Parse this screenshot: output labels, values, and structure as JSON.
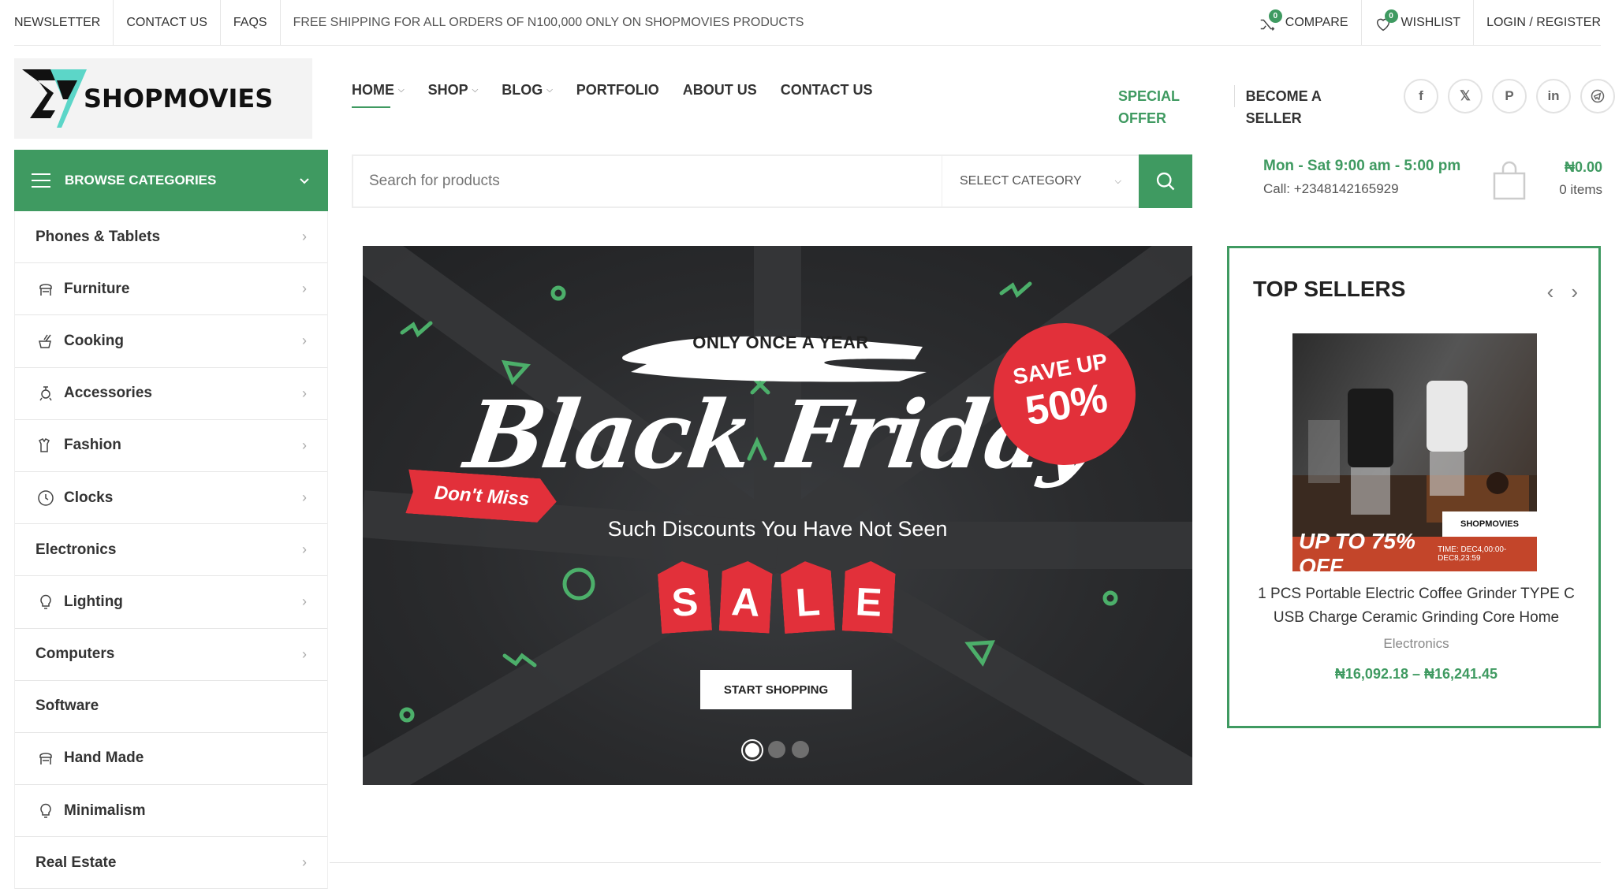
{
  "topbar": {
    "links": [
      "NEWSLETTER",
      "CONTACT US",
      "FAQS"
    ],
    "shipping_notice": "FREE SHIPPING FOR ALL ORDERS OF N100,000 ONLY ON SHOPMOVIES PRODUCTS",
    "compare": {
      "label": "COMPARE",
      "count": "0"
    },
    "wishlist": {
      "label": "WISHLIST",
      "count": "0"
    },
    "login": "LOGIN / REGISTER"
  },
  "header": {
    "logo_text": "SHOPMOVIES",
    "nav": [
      {
        "label": "HOME",
        "dropdown": true
      },
      {
        "label": "SHOP",
        "dropdown": true
      },
      {
        "label": "BLOG",
        "dropdown": true
      },
      {
        "label": "PORTFOLIO",
        "dropdown": false
      },
      {
        "label": "ABOUT US",
        "dropdown": false
      },
      {
        "label": "CONTACT US",
        "dropdown": false
      }
    ],
    "special_offer": "SPECIAL OFFER",
    "become_seller": "BECOME A SELLER",
    "social": [
      "facebook-icon",
      "x-icon",
      "pinterest-icon",
      "linkedin-icon",
      "telegram-icon"
    ]
  },
  "browse": {
    "label": "BROWSE CATEGORIES",
    "categories": [
      {
        "label": "Phones & Tablets",
        "icon": "",
        "arrow": true
      },
      {
        "label": "Furniture",
        "icon": "chair-icon",
        "arrow": true
      },
      {
        "label": "Cooking",
        "icon": "cooking-icon",
        "arrow": true
      },
      {
        "label": "Accessories",
        "icon": "accessories-icon",
        "arrow": true
      },
      {
        "label": "Fashion",
        "icon": "fashion-icon",
        "arrow": true
      },
      {
        "label": "Clocks",
        "icon": "clock-icon",
        "arrow": true
      },
      {
        "label": "Electronics",
        "icon": "",
        "arrow": true
      },
      {
        "label": "Lighting",
        "icon": "lightbulb-icon",
        "arrow": true
      },
      {
        "label": "Computers",
        "icon": "",
        "arrow": true
      },
      {
        "label": "Software",
        "icon": "",
        "arrow": false
      },
      {
        "label": "Hand Made",
        "icon": "chair-icon",
        "arrow": false
      },
      {
        "label": "Minimalism",
        "icon": "lightbulb-icon",
        "arrow": false
      },
      {
        "label": "Real Estate",
        "icon": "",
        "arrow": true
      }
    ]
  },
  "search": {
    "placeholder": "Search for products",
    "category_select": "SELECT CATEGORY"
  },
  "contact": {
    "hours": "Mon - Sat 9:00 am - 5:00 pm",
    "phone": "Call: +2348142165929"
  },
  "cart": {
    "amount": "₦0.00",
    "items": "0 items"
  },
  "banner": {
    "tagline": "ONLY ONCE A YEAR",
    "headline": "Black Friday",
    "save_line1": "SAVE UP",
    "save_line2": "50%",
    "dont_miss": "Don't Miss",
    "subtitle": "Such Discounts You Have Not Seen",
    "sale_letters": [
      "S",
      "A",
      "L",
      "E"
    ],
    "cta": "START SHOPPING",
    "slides": 3,
    "active_slide": 1
  },
  "top_sellers": {
    "title": "TOP SELLERS",
    "product": {
      "name": "1 PCS Portable Electric Coffee Grinder TYPE C USB Charge Ceramic Grinding Core Home",
      "category": "Electronics",
      "price": "₦16,092.18 – ₦16,241.45",
      "promo_text": "UP TO 75% OFF",
      "promo_time": "TIME: DEC4,00:00-DEC8,23:59",
      "logo_text": "SHOPMOVIES"
    }
  },
  "colors": {
    "accent": "#3f9a61",
    "sale_red": "#e2303a",
    "banner_bg": "#2a2b2d"
  }
}
